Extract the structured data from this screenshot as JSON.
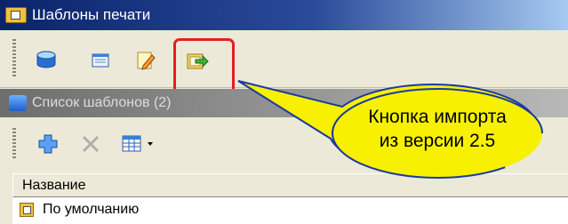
{
  "window": {
    "title": "Шаблоны печати"
  },
  "toolbar": {
    "buttons": [
      {
        "name": "database-icon"
      },
      {
        "name": "properties-icon"
      },
      {
        "name": "edit-pencil-icon"
      },
      {
        "name": "import-icon"
      }
    ]
  },
  "panel": {
    "title": "Список шаблонов (2)"
  },
  "list_toolbar": {
    "buttons": [
      {
        "name": "add-icon"
      },
      {
        "name": "delete-icon"
      },
      {
        "name": "view-dropdown-icon"
      }
    ]
  },
  "list": {
    "columns": [
      "Название"
    ],
    "rows": [
      {
        "label": "По умолчанию"
      }
    ]
  },
  "callout": {
    "line1": "Кнопка импорта",
    "line2": "из версии 2.5"
  },
  "colors": {
    "titlebar": "#0a246a",
    "highlight": "#e02020",
    "callout_fill": "#f7f000",
    "callout_border": "#1a3aa0"
  }
}
